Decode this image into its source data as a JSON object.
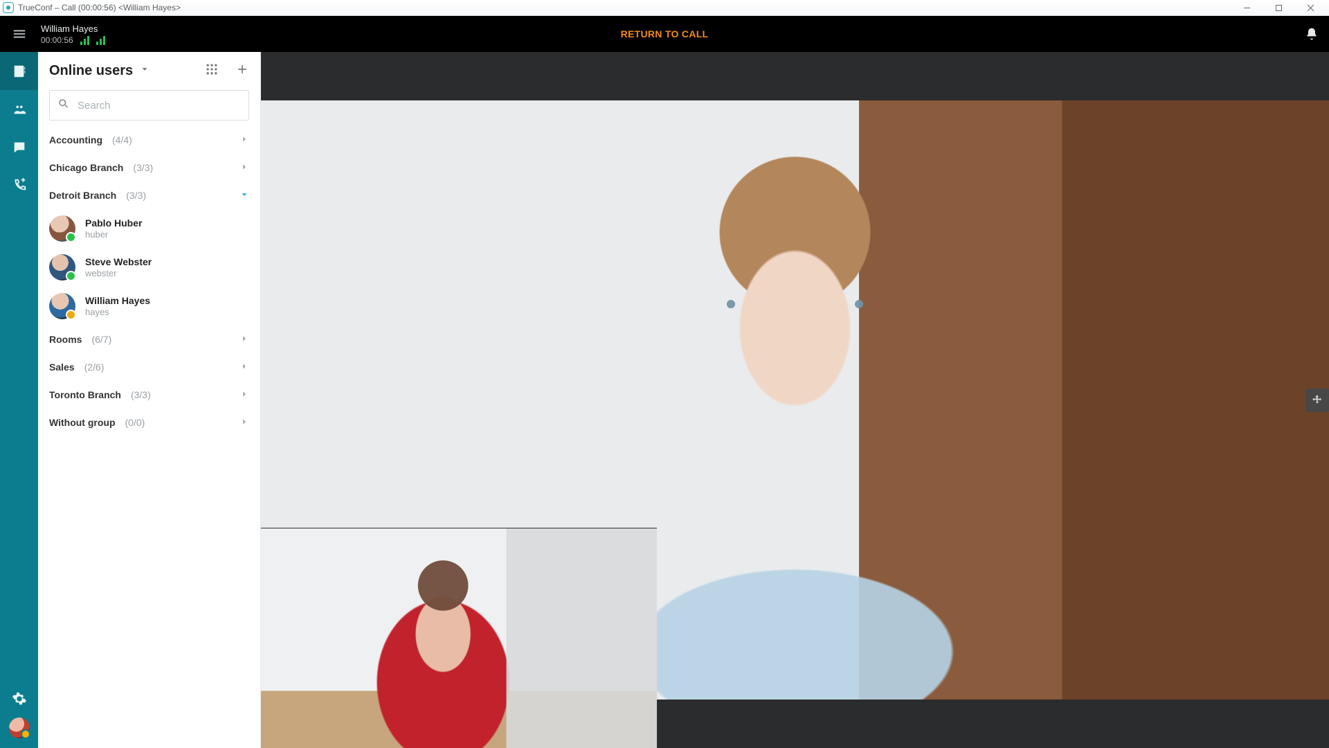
{
  "window": {
    "title": "TrueConf – Call (00:00:56) <William Hayes>"
  },
  "topbar": {
    "caller_name": "William Hayes",
    "call_timer": "00:00:56",
    "return_label": "RETURN TO CALL"
  },
  "panel": {
    "title": "Online users",
    "search_placeholder": "Search",
    "groups": [
      {
        "name": "Accounting",
        "count": "(4/4)",
        "expanded": false
      },
      {
        "name": "Chicago Branch",
        "count": "(3/3)",
        "expanded": false
      },
      {
        "name": "Detroit Branch",
        "count": "(3/3)",
        "expanded": true
      },
      {
        "name": "Rooms",
        "count": "(6/7)",
        "expanded": false
      },
      {
        "name": "Sales",
        "count": "(2/6)",
        "expanded": false
      },
      {
        "name": "Toronto Branch",
        "count": "(3/3)",
        "expanded": false
      },
      {
        "name": "Without group",
        "count": "(0/0)",
        "expanded": false
      }
    ],
    "detroit_people": [
      {
        "name": "Pablo Huber",
        "id": "huber",
        "status": "green"
      },
      {
        "name": "Steve Webster",
        "id": "webster",
        "status": "green"
      },
      {
        "name": "William Hayes",
        "id": "hayes",
        "status": "amber"
      }
    ]
  }
}
